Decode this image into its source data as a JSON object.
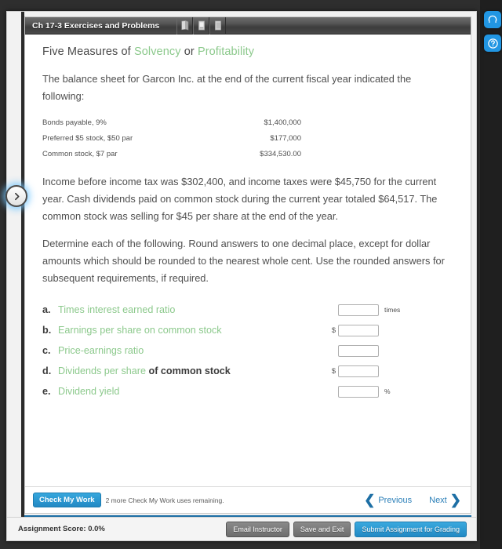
{
  "window": {
    "title": "Ch 17-3 Exercises and Problems",
    "tools": [
      {
        "name": "ebook-icon",
        "label": "eBook"
      },
      {
        "name": "print-icon",
        "label": "Print Item"
      },
      {
        "name": "document-icon",
        "label": "Show Work"
      }
    ]
  },
  "right_rail": [
    {
      "name": "headset-icon",
      "label": "Support"
    },
    {
      "name": "help-icon",
      "label": "Help"
    }
  ],
  "expander": {
    "name": "chevron-right-icon",
    "label": ">"
  },
  "exercise": {
    "title_prefix": "Five Measures of ",
    "title_link1": "Solvency",
    "title_mid": " or ",
    "title_link2": "Profitability",
    "intro": "The balance sheet for Garcon Inc. at the end of the current fiscal year indicated the following:",
    "balance_sheet": [
      {
        "label": "Bonds payable, 9%",
        "value": "$1,400,000"
      },
      {
        "label": "Preferred $5 stock, $50 par",
        "value": "$177,000"
      },
      {
        "label": "Common stock, $7 par",
        "value": "$334,530.00"
      }
    ],
    "income_paragraph": "Income before income tax was $302,400, and income taxes were $45,750 for the current year. Cash dividends paid on common stock during the current year totaled $64,517. The common stock was selling for $45 per share at the end of the year.",
    "instructions": "Determine each of the following. Round answers to one decimal place, except for dollar amounts which should be rounded to the nearest whole cent. Use the rounded answers for subsequent requirements, if required.",
    "requirements": [
      {
        "letter": "a.",
        "label_green": "Times interest earned ratio",
        "label_dark": "",
        "prefix": "",
        "value": "",
        "unit": "times"
      },
      {
        "letter": "b.",
        "label_green": "Earnings per share on common stock",
        "label_dark": "",
        "prefix": "$",
        "value": "",
        "unit": ""
      },
      {
        "letter": "c.",
        "label_green": "Price-earnings ratio",
        "label_dark": "",
        "prefix": "",
        "value": "",
        "unit": ""
      },
      {
        "letter": "d.",
        "label_green": "Dividends per share",
        "label_dark": " of common stock",
        "prefix": "$",
        "value": "",
        "unit": ""
      },
      {
        "letter": "e.",
        "label_green": "Dividend yield",
        "label_dark": "",
        "prefix": "",
        "value": "",
        "unit": "%"
      }
    ]
  },
  "card_footer": {
    "check_my_work": "Check My Work",
    "uses_note": "2 more Check My Work uses remaining.",
    "previous": "Previous",
    "next": "Next",
    "prev_chevron": "❮",
    "next_chevron": "❯"
  },
  "assignment_footer": {
    "score_label": "Assignment Score: 0.0%",
    "buttons": [
      {
        "name": "email-instructor-button",
        "label": "Email Instructor",
        "primary": false
      },
      {
        "name": "save-and-exit-button",
        "label": "Save and Exit",
        "primary": false
      },
      {
        "name": "submit-assignment-button",
        "label": "Submit Assignment for Grading",
        "primary": true
      }
    ]
  },
  "colors": {
    "link_green": "#8cc98c",
    "accent_blue": "#2289c4",
    "rule_blue": "#1c6ea4"
  }
}
